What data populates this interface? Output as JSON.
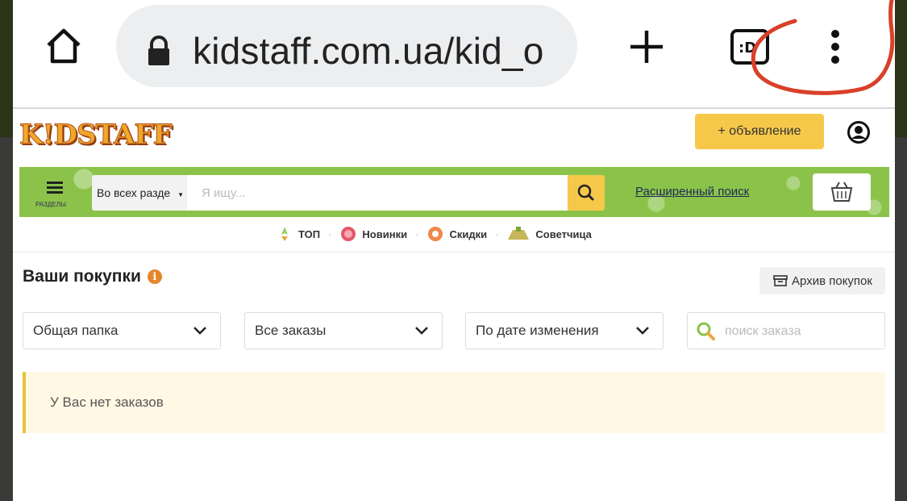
{
  "browser": {
    "url": "kidstaff.com.ua/kid_o"
  },
  "site": {
    "logo_text": "K!DSTAFF",
    "add_listing_label": "+ объявление",
    "search": {
      "scope": "Во всех разде",
      "placeholder": "Я ищу...",
      "advanced_link": "Расширенный поиск",
      "sections_label": "РАЗДЕЛЫ"
    },
    "quicknav": [
      {
        "label": "ТОП",
        "icon": "rocket-icon"
      },
      {
        "label": "Новинки",
        "icon": "new-badge-icon"
      },
      {
        "label": "Скидки",
        "icon": "discount-icon"
      },
      {
        "label": "Советчица",
        "icon": "advisor-icon"
      }
    ]
  },
  "purchases": {
    "title": "Ваши покупки",
    "archive_label": "Архив покупок",
    "filters": [
      "Общая папка",
      "Все заказы",
      "По дате изменения"
    ],
    "order_search_placeholder": "поиск заказа",
    "empty_message": "У Вас нет заказов"
  },
  "colors": {
    "accent_yellow": "#f6c84a",
    "search_green": "#8bc34a",
    "annotation_red": "#d8402a"
  }
}
